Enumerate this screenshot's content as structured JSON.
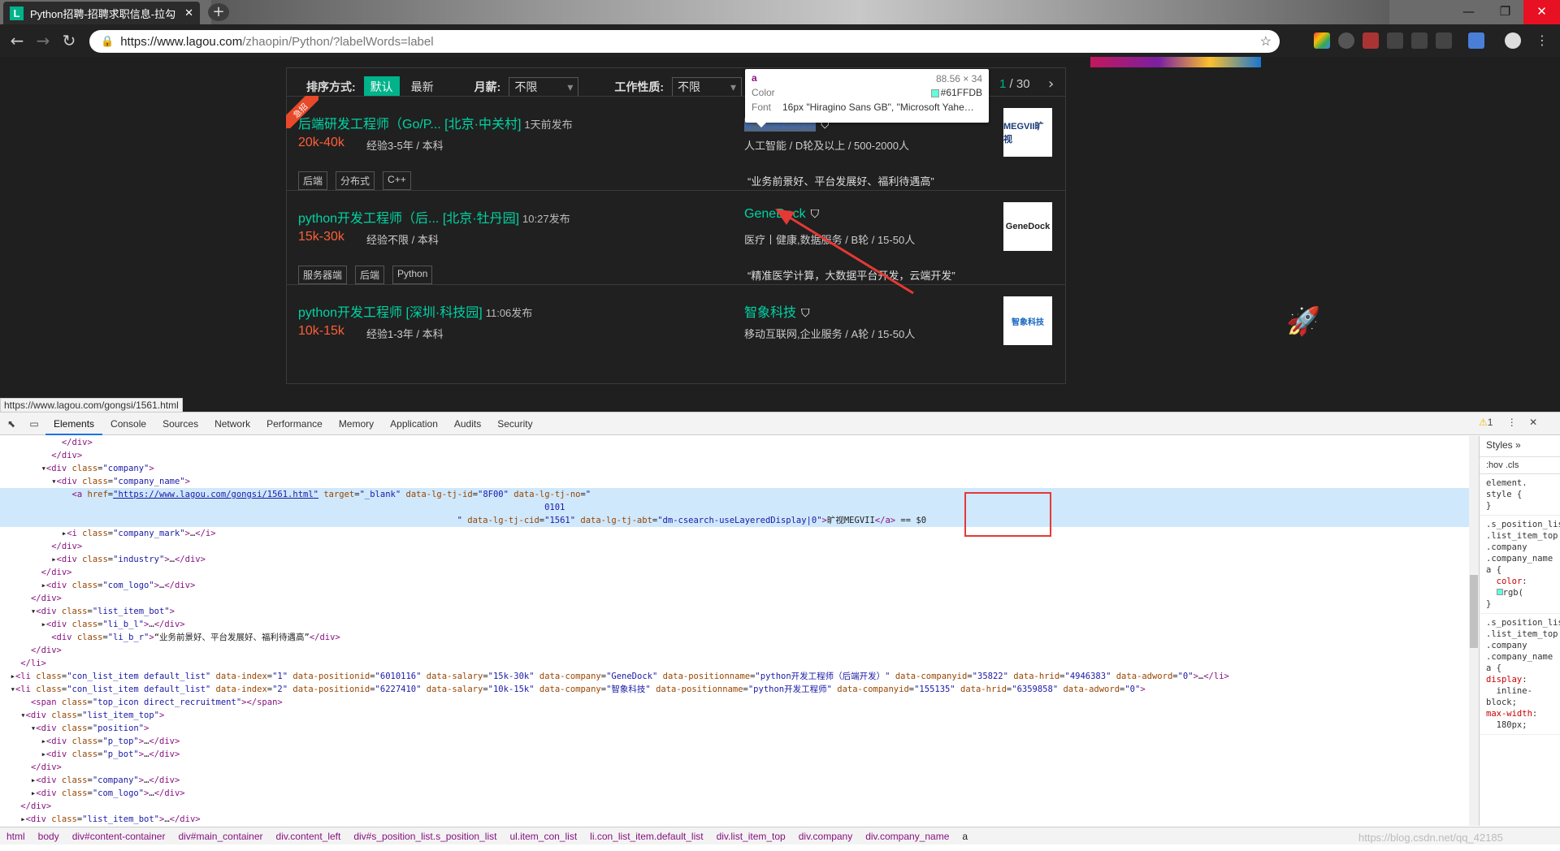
{
  "browser": {
    "tab_title": "Python招聘-招聘求职信息-拉勾",
    "favicon_letter": "L",
    "url_host": "https://www.lagou.com",
    "url_path": "/zhaopin/Python/?labelWords=label"
  },
  "filters": {
    "sort_label": "排序方式:",
    "sort_default": "默认",
    "sort_latest": "最新",
    "salary_label": "月薪:",
    "salary_value": "不限",
    "jobtype_label": "工作性质:",
    "jobtype_value": "不限",
    "page_current": "1",
    "page_total": "/ 30"
  },
  "tooltip": {
    "tag": "a",
    "dims": "88.56 × 34",
    "color_label": "Color",
    "color_value": "#61FFDB",
    "font_label": "Font",
    "font_value": "16px \"Hiragino Sans GB\", \"Microsoft Yahe…"
  },
  "jobs": [
    {
      "badge": "急招",
      "title": "后端研发工程师（Go/P... [北京·中关村]",
      "published": "1天前发布",
      "salary": "20k-40k",
      "requirement": "经验3-5年 / 本科",
      "tags": [
        "后端",
        "分布式",
        "C++"
      ],
      "company": "旷视MEGVII",
      "industry": "人工智能 / D轮及以上 / 500-2000人",
      "slogan": "“业务前景好、平台发展好、福利待遇高”",
      "logo": "MEGVII旷视"
    },
    {
      "title": "python开发工程师（后... [北京·牡丹园]",
      "published": "10:27发布",
      "salary": "15k-30k",
      "requirement": "经验不限 / 本科",
      "tags": [
        "服务器端",
        "后端",
        "Python"
      ],
      "company": "GeneDock",
      "industry": "医疗丨健康,数据服务 / B轮 / 15-50人",
      "slogan": "“精准医学计算，大数据平台开发，云端开发”",
      "logo": "GeneDock"
    },
    {
      "title": "python开发工程师 [深圳·科技园]",
      "published": "11:06发布",
      "salary": "10k-15k",
      "requirement": "经验1-3年 / 本科",
      "company": "智象科技",
      "industry": "移动互联网,企业服务 / A轮 / 15-50人",
      "logo": "智象科技"
    }
  ],
  "status_url": "https://www.lagou.com/gongsi/1561.html",
  "devtools": {
    "tabs": [
      "Elements",
      "Console",
      "Sources",
      "Network",
      "Performance",
      "Memory",
      "Application",
      "Audits",
      "Security"
    ],
    "warning_count": "1",
    "styles_tab": "Styles",
    "styles_filter": ":hov .cls",
    "breadcrumbs": [
      "html",
      "body",
      "div#content-container",
      "div#main_container",
      "div.content_left",
      "div#s_position_list.s_position_list",
      "ul.item_con_list",
      "li.con_list_item.default_list",
      "div.list_item_top",
      "div.company",
      "div.company_name",
      "a"
    ],
    "watermark": "https://blog.csdn.net/qq_42185"
  },
  "colors": {
    "accent": "#00b38a",
    "salary": "#fd5f39",
    "company": "#00d3a3"
  }
}
